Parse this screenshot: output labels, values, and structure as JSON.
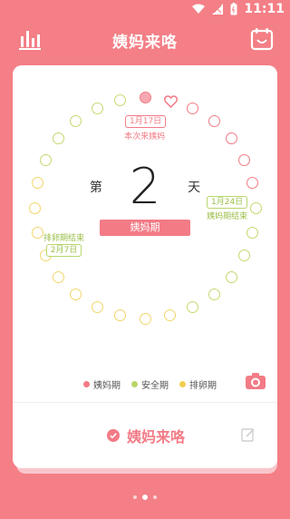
{
  "status_bar": {
    "time": "11:11"
  },
  "header": {
    "title": "姨妈来咯",
    "left_icon": "stats-chart-icon",
    "right_icon": "calendar-icon"
  },
  "cycle": {
    "day_prefix": "第",
    "day_number": "2",
    "day_suffix": "天",
    "phase": "姨妈期",
    "markers": {
      "next_period_date": "1月17日",
      "next_period_label": "本次来姨妈",
      "period_end_date": "1月24日",
      "period_end_label": "姨妈期结束",
      "ovulation_end_label": "排卵期结束",
      "ovulation_end_date": "2月7日"
    }
  },
  "legend": [
    {
      "label": "姨妈期",
      "color": "#f27b86"
    },
    {
      "label": "安全期",
      "color": "#b7d66b"
    },
    {
      "label": "排卵期",
      "color": "#f2cf4f"
    }
  ],
  "action": {
    "label": "姨妈来咯"
  },
  "pager": {
    "count": 3,
    "active": 1
  },
  "colors": {
    "background": "#f47f86",
    "accent": "#f27b86",
    "safe": "#c3d96f",
    "ovulation": "#f2d56a"
  }
}
